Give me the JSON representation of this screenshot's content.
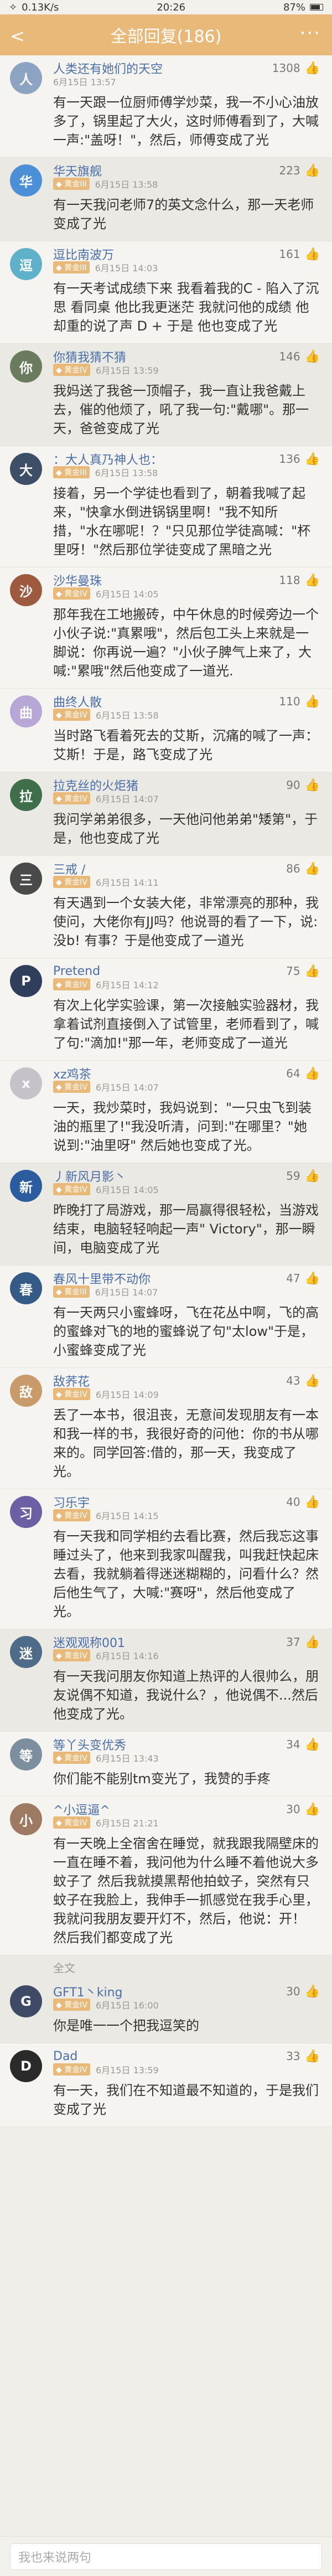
{
  "status": {
    "network": "0.13K/s",
    "time": "20:26",
    "battery": "87%"
  },
  "header": {
    "title": "全部回复(186)"
  },
  "replies": [
    {
      "name": "人类还有她们的天空",
      "likes": "1308",
      "date": "6月15日 13:57",
      "badge": "",
      "avatar_color": "#8da3c2",
      "avatar_letter": "人",
      "text": "有一天跟一位厨师傅学炒菜，我一不小心油放多了，锅里起了大火，这时师傅看到了，大喊一声:\"盖呀！\"，然后，师傅变成了光"
    },
    {
      "name": "华天旗舰",
      "likes": "223",
      "date": "6月15日 13:58",
      "badge": "黄金III",
      "avatar_color": "#4b8fd6",
      "avatar_letter": "华",
      "text": "有一天我问老师7的英文念什么，那一天老师变成了光"
    },
    {
      "name": "逗比南波万",
      "likes": "161",
      "date": "6月15日 14:03",
      "badge": "黄金III",
      "avatar_color": "#5fb1c9",
      "avatar_letter": "逗",
      "text": "有一天考试成绩下来 我看着我的C - 陷入了沉思 看同桌 他比我更迷茫 我就问他的成绩 他却重的说了声 D + 于是 他也变成了光"
    },
    {
      "name": "你猜我猜不猜",
      "likes": "146",
      "date": "6月15日 13:59",
      "badge": "黄金IV",
      "avatar_color": "#6a7b5e",
      "avatar_letter": "你",
      "text": "我妈送了我爸一顶帽子，我一直让我爸戴上去，催的他烦了，吼了我一句:\"戴哪\"。那一天，爸爸变成了光"
    },
    {
      "name": "：大人真乃神人也：",
      "likes": "136",
      "date": "6月15日 13:58",
      "badge": "黄金III",
      "avatar_color": "#3c4f66",
      "avatar_letter": "大",
      "text": "接着，另一个学徒也看到了，朝着我喊了起来，\"快拿水倒进锅锅里啊！\"我不知所措，\"水在哪呢！？\"只见那位学徒高喊：\"杯里呀！\"然后那位学徒变成了黑暗之光"
    },
    {
      "name": "沙华曼珠",
      "likes": "118",
      "date": "6月15日 14:05",
      "badge": "黄金IV",
      "avatar_color": "#9d5a3e",
      "avatar_letter": "沙",
      "text": "那年我在工地搬砖，中午休息的时候旁边一个小伙子说:\"真累哦\"，然后包工头上来就是一脚说：你再说一遍？\"小伙子脾气上来了，大喊:\"累哦\"然后他变成了一道光."
    },
    {
      "name": "曲终人散",
      "likes": "110",
      "date": "6月15日 13:58",
      "badge": "黄金IV",
      "avatar_color": "#b6a7d6",
      "avatar_letter": "曲",
      "text": "当时路飞看着死去的艾斯，沉痛的喊了一声：艾斯！于是，路飞变成了光"
    },
    {
      "name": "拉克丝的火炬猪",
      "likes": "90",
      "date": "6月15日 14:07",
      "badge": "黄金IV",
      "avatar_color": "#3e6f4a",
      "avatar_letter": "拉",
      "text": "我问学弟弟很多，一天他问他弟弟\"矮第\"，于是，他也变成了光"
    },
    {
      "name": "三戒 /",
      "likes": "86",
      "date": "6月15日 14:11",
      "badge": "黄金IV",
      "avatar_color": "#4a4a4a",
      "avatar_letter": "三",
      "text": "有天遇到一个女装大佬，非常漂亮的那种，我使问，大佬你有JJ吗？他说哥的看了一下，说:没b! 有事？于是他变成了一道光"
    },
    {
      "name": "Pretend",
      "likes": "75",
      "date": "6月15日 14:12",
      "badge": "黄金IV",
      "avatar_color": "#2f3e5a",
      "avatar_letter": "P",
      "text": "有次上化学实验课，第一次接触实验器材，我拿着试剂直接倒入了试管里，老师看到了，喊了句:\"滴加!\"那一年，老师变成了一道光"
    },
    {
      "name": "xz鸡茶",
      "likes": "64",
      "date": "6月15日 14:07",
      "badge": "黄金IV",
      "avatar_color": "#c7c1c9",
      "avatar_letter": "x",
      "text": "一天，我炒菜时，我妈说到：\"一只虫飞到装油的瓶里了!\"我没听清，问到:\"在哪里？\"她说到:\"油里呀\" 然后她也变成了光。"
    },
    {
      "name": "丿新风月影丶",
      "likes": "59",
      "date": "6月15日 14:05",
      "badge": "黄金IV",
      "avatar_color": "#2b5c9e",
      "avatar_letter": "新",
      "text": "昨晚打了局游戏，那一局赢得很轻松，当游戏结束，电脑轻轻响起一声\" Victory\"，那一瞬间，电脑变成了光"
    },
    {
      "name": "春风十里带不动你",
      "likes": "47",
      "date": "6月15日 14:07",
      "badge": "黄金III",
      "avatar_color": "#345a86",
      "avatar_letter": "春",
      "text": "有一天两只小蜜蜂呀，飞在花丛中啊，飞的高的蜜蜂对飞的地的蜜蜂说了句\"太low\"于是，小蜜蜂变成了光"
    },
    {
      "name": "敌荞花",
      "likes": "43",
      "date": "6月15日 14:09",
      "badge": "黄金IV",
      "avatar_color": "#c99a6a",
      "avatar_letter": "敌",
      "text": "丢了一本书，很沮丧，无意间发现朋友有一本和我一样的书，我很好奇的问他：你的书从哪来的。同学回答:借的，那一天，我变成了光。"
    },
    {
      "name": "习乐宇",
      "likes": "40",
      "date": "6月15日 14:15",
      "badge": "黄金IV",
      "avatar_color": "#6d5fa3",
      "avatar_letter": "习",
      "text": "有一天我和同学相约去看比赛，然后我忘这事睡过头了，他来到我家叫醒我，叫我赶快起床去看，我就躺着得迷迷糊糊的，问看什么？然后他生气了，大喊:\"赛呀\"，然后他变成了光。"
    },
    {
      "name": "迷观观称001",
      "likes": "37",
      "date": "6月15日 14:16",
      "badge": "黄金IV",
      "avatar_color": "#4f6b8a",
      "avatar_letter": "迷",
      "text": "有一天我问朋友你知道上热评的人很帅么，朋友说偶不知道，我说什么？，他说偶不...然后他变成了光。"
    },
    {
      "name": "等丫头变优秀",
      "likes": "34",
      "date": "6月15日 13:43",
      "badge": "黄金IV",
      "avatar_color": "#7b8f9e",
      "avatar_letter": "等",
      "text": "你们能不能别tm变光了，我赞的手疼"
    },
    {
      "name": "^小逗逼^",
      "likes": "30",
      "date": "6月15日 21:21",
      "badge": "黄金IV",
      "avatar_color": "#9e7a63",
      "avatar_letter": "小",
      "text": "有一天晚上全宿舍在睡觉，就我跟我隔壁床的一直在睡不着，我问他为什么睡不着他说大多蚊子了 然后我就摸黑帮他拍蚊子，突然有只蚊子在我脸上，我伸手一抓感觉在我手心里，我就问我朋友要开灯不，然后，他说：开！ 然后我们都变成了光"
    },
    {
      "name": "GFT1丶king",
      "likes": "30",
      "date": "6月15日 16:00",
      "badge": "黄金IV",
      "avatar_color": "#3f4b66",
      "avatar_letter": "G",
      "text": "你是唯一一个把我逗笑的"
    },
    {
      "name": "Dad",
      "likes": "33",
      "date": "6月15日 13:59",
      "badge": "黄金IV",
      "avatar_color": "#2a2a2a",
      "avatar_letter": "D",
      "text": "有一天，我们在不知道最不知道的，于是我们变成了光"
    }
  ],
  "section_tag": "全文",
  "reply_placeholder": "我也来说两句"
}
